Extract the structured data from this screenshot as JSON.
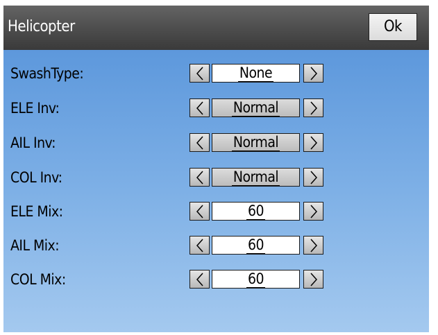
{
  "window": {
    "title": "Helicopter",
    "ok_label": "Ok"
  },
  "rows": [
    {
      "label": "SwashType:",
      "value": "None",
      "style": "white"
    },
    {
      "label": "ELE Inv:",
      "value": "Normal",
      "style": "grey"
    },
    {
      "label": "AIL Inv:",
      "value": "Normal",
      "style": "grey"
    },
    {
      "label": "COL Inv:",
      "value": "Normal",
      "style": "grey"
    },
    {
      "label": "ELE Mix:",
      "value": "60",
      "style": "white"
    },
    {
      "label": "AIL Mix:",
      "value": "60",
      "style": "white"
    },
    {
      "label": "COL Mix:",
      "value": "60",
      "style": "white"
    }
  ],
  "icons": {
    "decrement": "chevron-left-icon",
    "increment": "chevron-right-icon"
  }
}
